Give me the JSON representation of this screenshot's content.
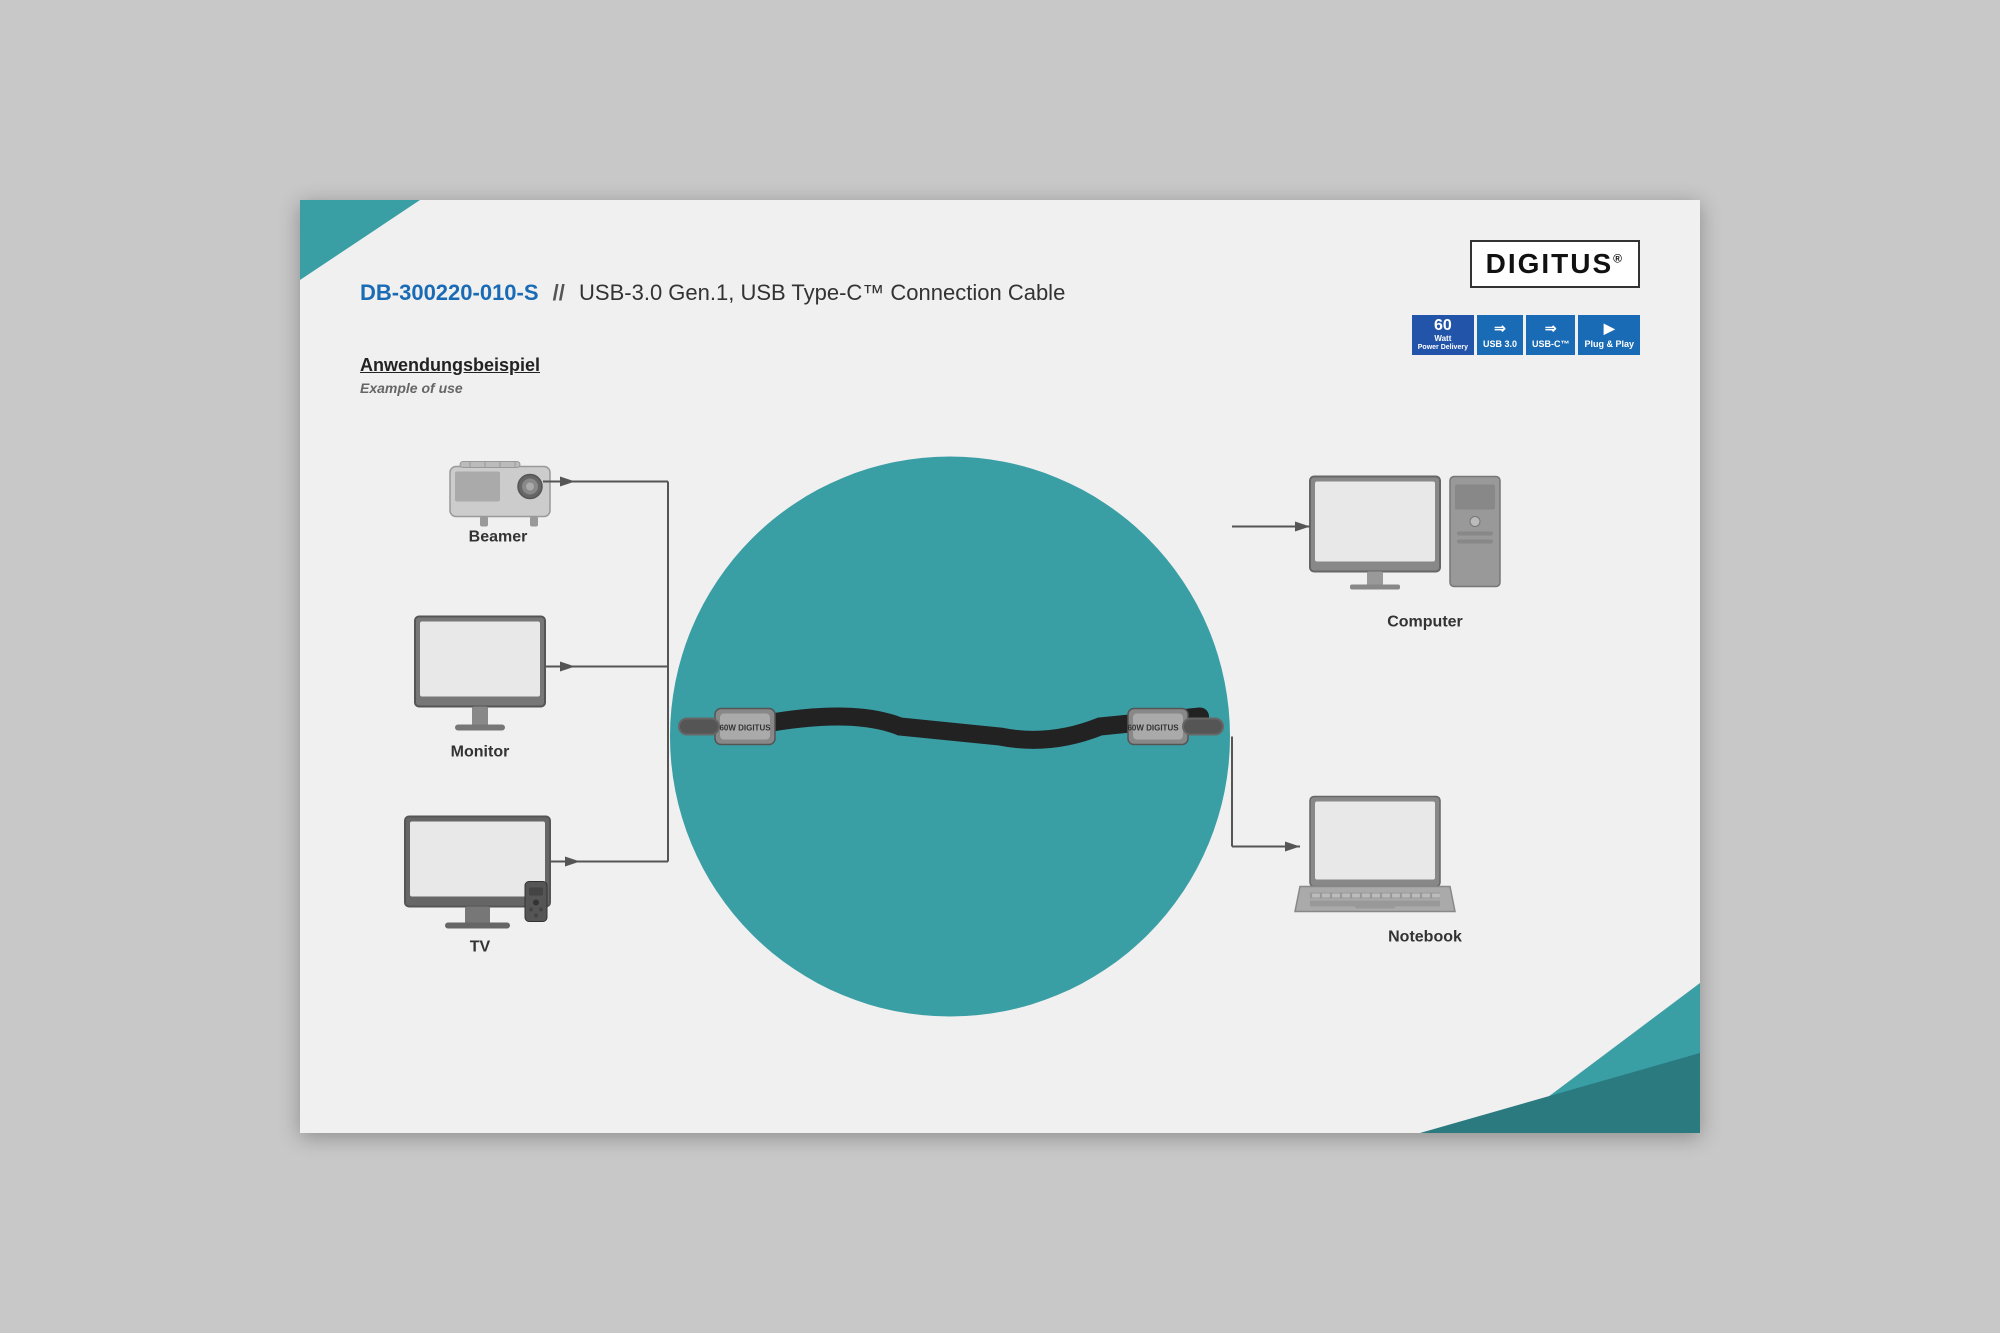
{
  "logo": {
    "text": "DIGITUS",
    "reg_symbol": "®"
  },
  "header": {
    "product_id": "DB-300220-010-S",
    "separator": "//",
    "product_name": "USB-3.0 Gen.1, USB Type-C™ Connection Cable"
  },
  "badges": [
    {
      "id": "badge-watt",
      "top": "60",
      "label": "Watt",
      "sublabel": "Power Delivery"
    },
    {
      "id": "badge-usb3",
      "icon": "→",
      "label": "USB 3.0"
    },
    {
      "id": "badge-usbc",
      "icon": "→",
      "label": "USB-C™"
    },
    {
      "id": "badge-pnp",
      "icon": "▶",
      "label": "Plug & Play"
    }
  ],
  "section": {
    "german": "Anwendungsbeispiel",
    "english": "Example of use"
  },
  "left_devices": [
    {
      "id": "beamer",
      "label": "Beamer"
    },
    {
      "id": "monitor",
      "label": "Monitor"
    },
    {
      "id": "tv",
      "label": "TV"
    }
  ],
  "right_devices": [
    {
      "id": "computer",
      "label": "Computer"
    },
    {
      "id": "notebook",
      "label": "Notebook"
    }
  ],
  "cable": {
    "brand": "60W DIGITUS"
  },
  "colors": {
    "teal": "#3a9ea5",
    "blue": "#1a6bb5",
    "dark": "#333333",
    "mid_gray": "#888888"
  }
}
